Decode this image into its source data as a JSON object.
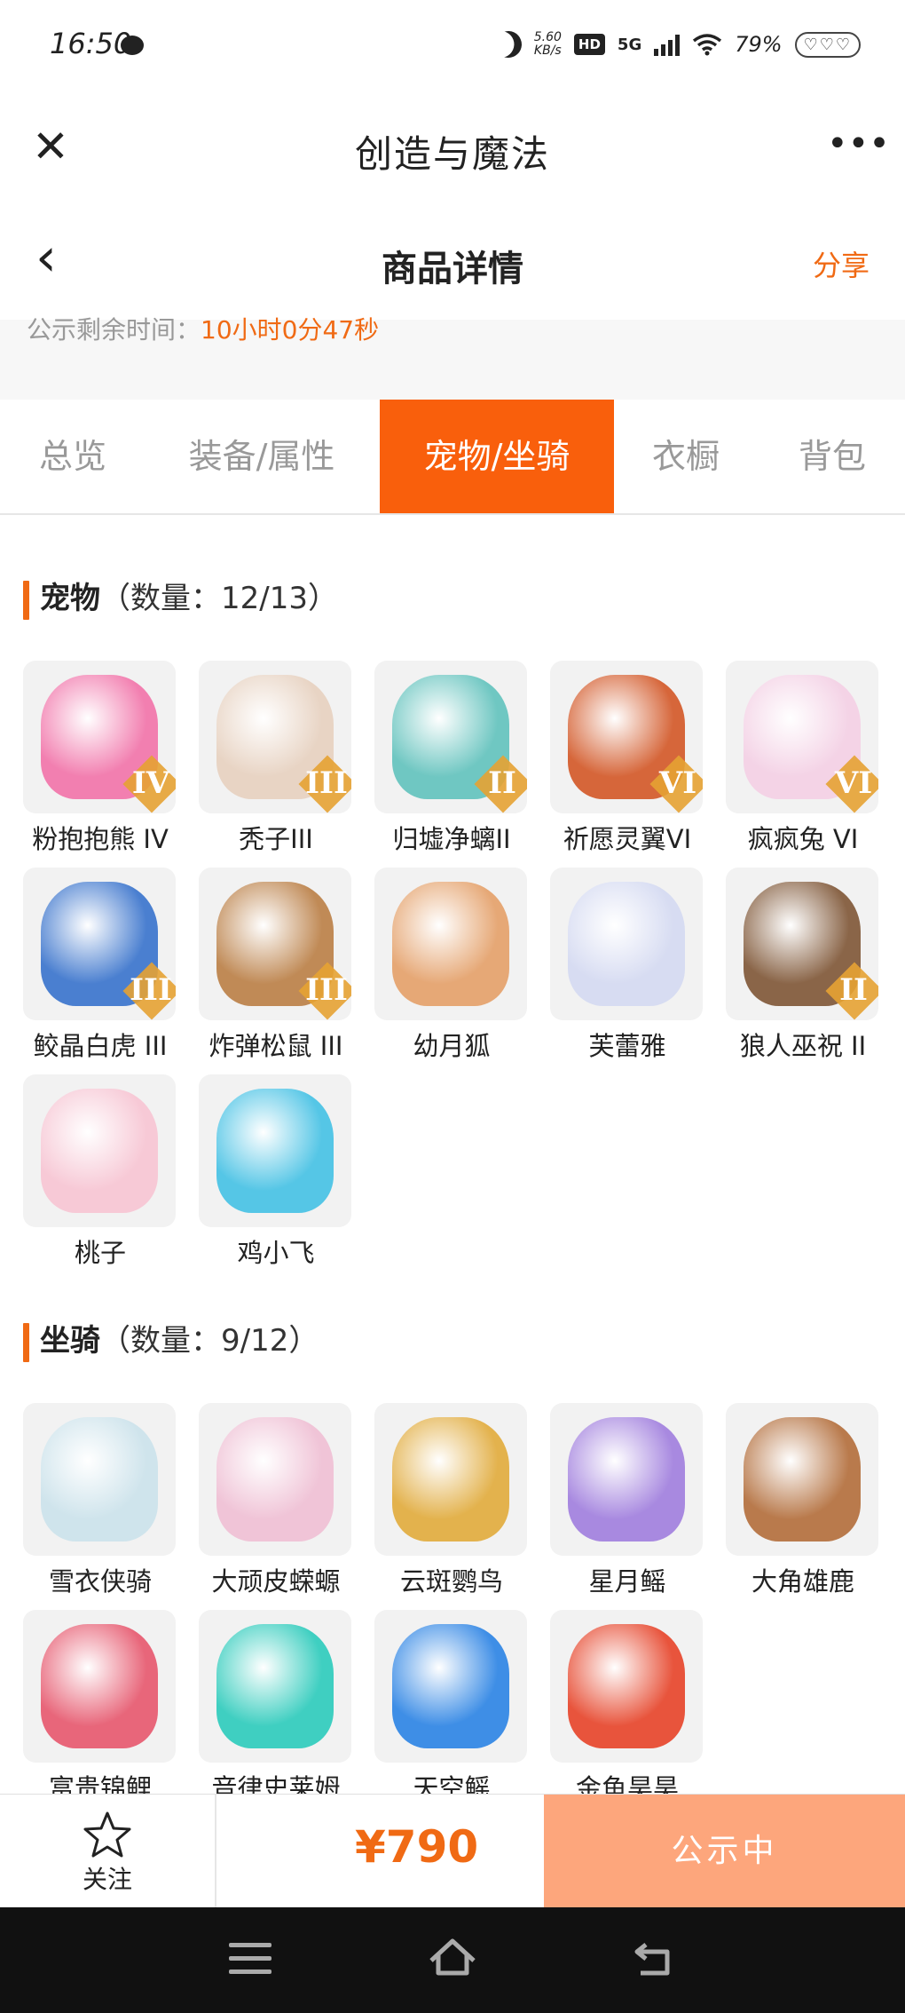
{
  "status_bar": {
    "time": "16:50",
    "net_speed_value": "5.60",
    "net_speed_unit": "KB/s",
    "hd": "HD",
    "network": "5G",
    "battery": "79%",
    "hearts": "♡♡♡"
  },
  "mini_app": {
    "title": "创造与魔法",
    "close_glyph": "✕",
    "more_glyph": "•••"
  },
  "header": {
    "back_glyph": "‹",
    "title": "商品详情",
    "share": "分享"
  },
  "publicity": {
    "label": "公示剩余时间：",
    "value": "10小时0分47秒"
  },
  "tabs": [
    {
      "label": "总览",
      "active": false
    },
    {
      "label": "装备/属性",
      "active": false
    },
    {
      "label": "宠物/坐骑",
      "active": true
    },
    {
      "label": "衣橱",
      "active": false
    },
    {
      "label": "背包",
      "active": false
    }
  ],
  "pets": {
    "title": "宠物",
    "count": "（数量：12/13）",
    "items": [
      {
        "label": "粉抱抱熊 IV",
        "rank": "IV",
        "color": "#f27fb0"
      },
      {
        "label": "秃子III",
        "rank": "III",
        "color": "#e8d4c4"
      },
      {
        "label": "归墟净螭II",
        "rank": "II",
        "color": "#6fc7c2"
      },
      {
        "label": "祈愿灵翼VI",
        "rank": "VI",
        "color": "#d6663a"
      },
      {
        "label": "疯疯兔 VI",
        "rank": "VI",
        "color": "#f4d3e6"
      },
      {
        "label": "鲛晶白虎 III",
        "rank": "III",
        "color": "#4a7fd0"
      },
      {
        "label": "炸弹松鼠 III",
        "rank": "III",
        "color": "#c08a56"
      },
      {
        "label": "幼月狐",
        "rank": "",
        "color": "#e6a876"
      },
      {
        "label": "芙蕾雅",
        "rank": "",
        "color": "#d7dcf2"
      },
      {
        "label": "狼人巫祝 II",
        "rank": "II",
        "color": "#8a6548"
      },
      {
        "label": "桃子",
        "rank": "",
        "color": "#f7c9d6"
      },
      {
        "label": "鸡小飞",
        "rank": "",
        "color": "#55c6e6"
      }
    ]
  },
  "mounts": {
    "title": "坐骑",
    "count": "（数量：9/12）",
    "items": [
      {
        "label": "雪衣侠骑",
        "color": "#cfe4ec"
      },
      {
        "label": "大顽皮蝾螈",
        "color": "#f0c4d7"
      },
      {
        "label": "云斑鹦鸟",
        "color": "#e3b24d"
      },
      {
        "label": "星月鳐",
        "color": "#a889e0"
      },
      {
        "label": "大角雄鹿",
        "color": "#b97a4c"
      },
      {
        "label": "富贵锦鲤",
        "color": "#e8667a"
      },
      {
        "label": "音律史莱姆",
        "color": "#3fcfc1"
      },
      {
        "label": "天空鳐",
        "color": "#3e8ee6"
      },
      {
        "label": "金鱼昊昊",
        "color": "#e8543c"
      }
    ]
  },
  "bottom": {
    "follow_label": "关注",
    "price": "¥790",
    "status": "公示中"
  }
}
